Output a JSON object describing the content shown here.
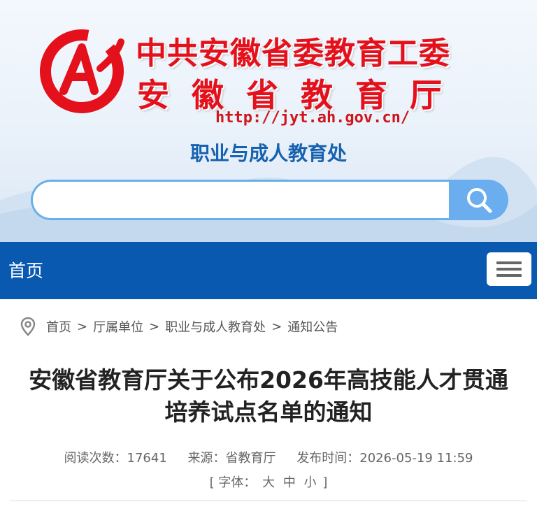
{
  "header": {
    "org_line1": "中共安徽省委教育工委",
    "org_line2": "安徽省教育厅",
    "url": "http://jyt.ah.gov.cn/",
    "department": "职业与成人教育处",
    "search_placeholder": "",
    "brand_red": "#e4101b",
    "brand_blue": "#1662b0"
  },
  "nav": {
    "home": "首页",
    "bar_color": "#0a59b0"
  },
  "breadcrumb": [
    {
      "label": "首页"
    },
    {
      "label": "厅属单位"
    },
    {
      "label": "职业与成人教育处"
    },
    {
      "label": "通知公告"
    }
  ],
  "breadcrumb_sep": ">",
  "article": {
    "title_line1": "安徽省教育厅关于公布2026年高技能人才贯通",
    "title_line2": "培养试点名单的通知",
    "reads": "阅读次数：17641",
    "source": "来源：省教育厅",
    "published": "发布时间：2026-05-19 11:59",
    "font_label": "[ 字体：",
    "font_large": "大",
    "font_medium": "中",
    "font_small": "小",
    "font_close": "]"
  }
}
